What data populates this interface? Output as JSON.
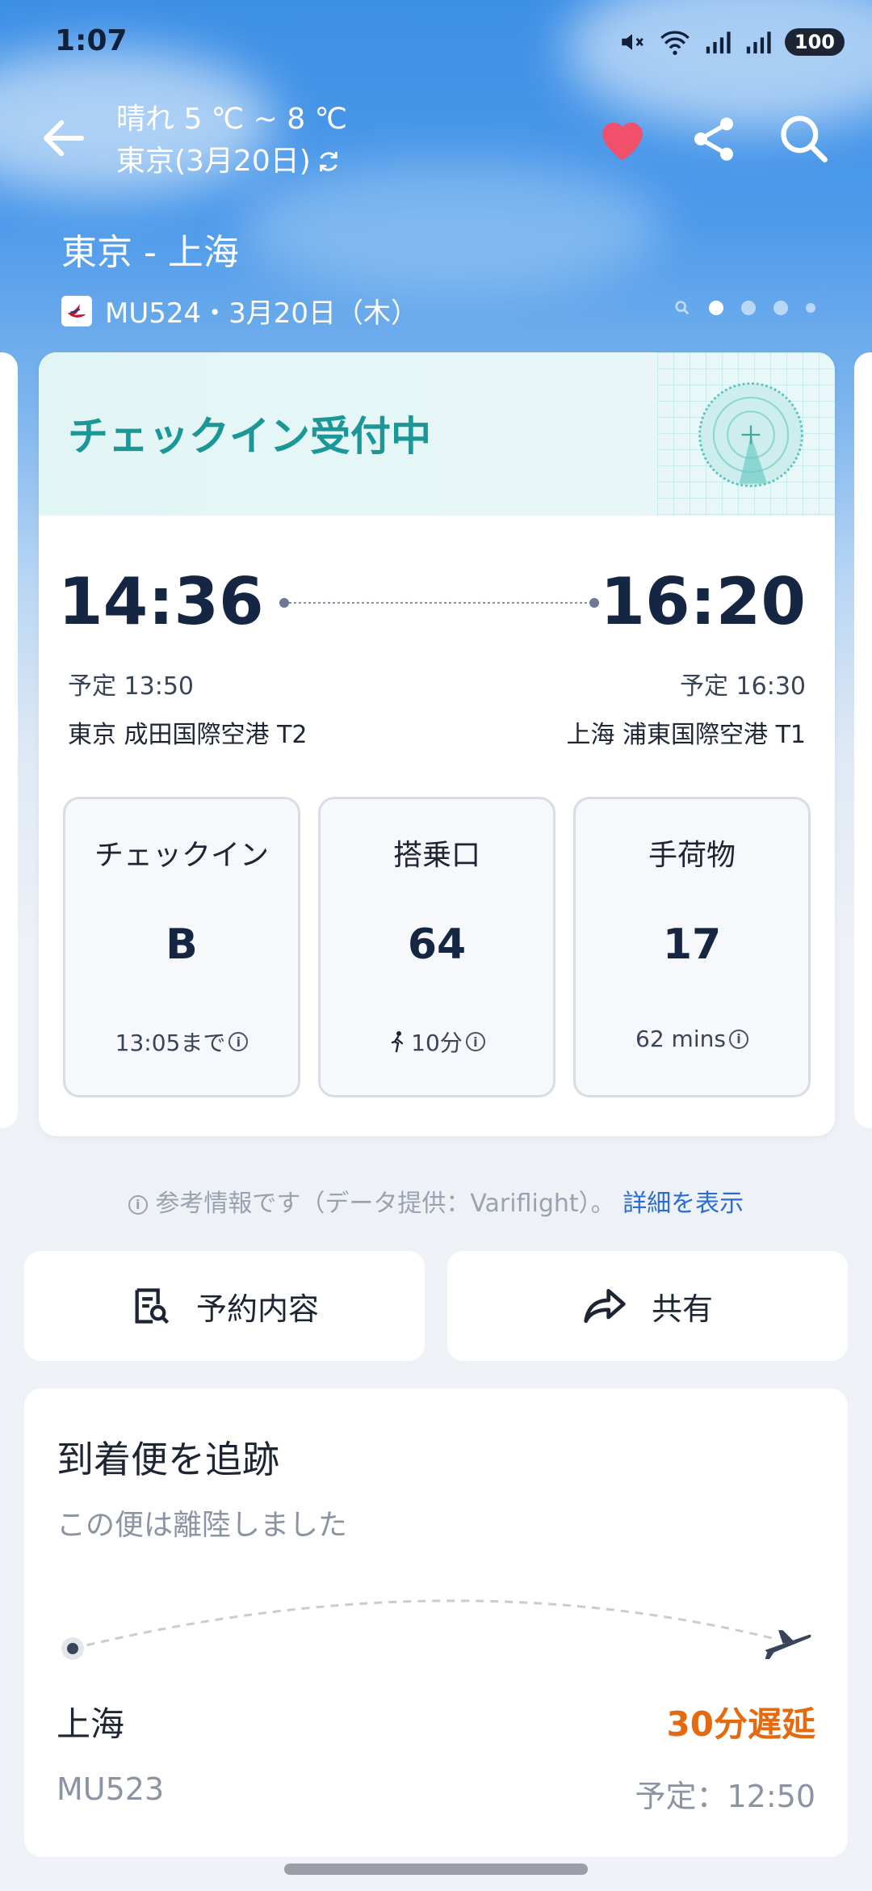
{
  "status_bar": {
    "time": "1:07",
    "battery": "100"
  },
  "header": {
    "weather": "晴れ 5 ℃ ~ 8 ℃",
    "city_date": "東京(3月20日)",
    "route": "東京 - 上海",
    "flight_info": "MU524・3月20日（木）"
  },
  "card": {
    "status": "チェックイン受付中",
    "dep_time": "14:36",
    "arr_time": "16:20",
    "dep_scheduled": "予定 13:50",
    "arr_scheduled": "予定 16:30",
    "dep_airport": "東京 成田国際空港 T2",
    "arr_airport": "上海 浦東国際空港 T1",
    "boxes": [
      {
        "label": "チェックイン",
        "value": "B",
        "sub": "13:05まで"
      },
      {
        "label": "搭乗口",
        "value": "64",
        "sub": "10分"
      },
      {
        "label": "手荷物",
        "value": "17",
        "sub": "62 mins"
      }
    ]
  },
  "reference": {
    "text": "参考情報です（データ提供：Variflight）。",
    "link": "詳細を表示"
  },
  "buttons": {
    "booking": "予約内容",
    "share": "共有"
  },
  "tracking": {
    "title": "到着便を追跡",
    "subtitle": "この便は離陸しました",
    "city": "上海",
    "delay": "30分遅延",
    "flight": "MU523",
    "scheduled": "予定：12:50"
  },
  "colors": {
    "accent_teal": "#1a9796",
    "link_blue": "#2a6bd6",
    "delay_orange": "#e4690f",
    "heart": "#f0506a"
  }
}
